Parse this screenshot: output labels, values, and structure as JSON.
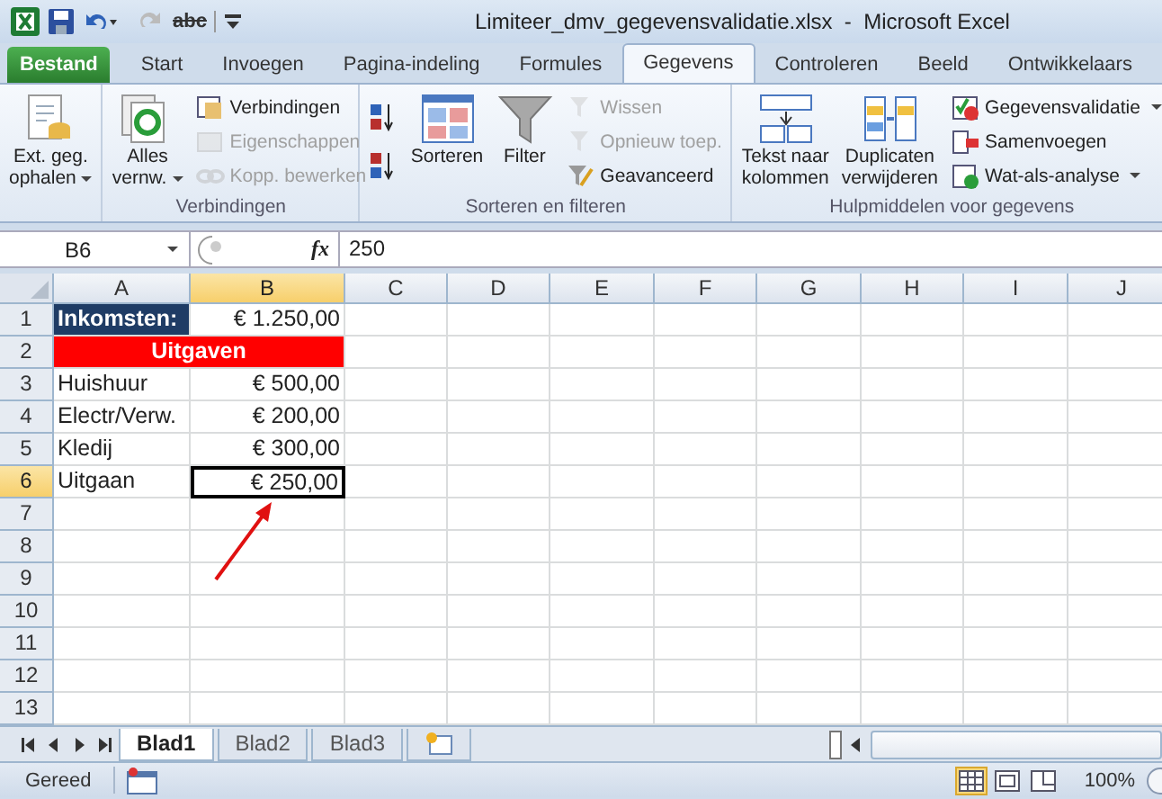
{
  "window": {
    "title": "Limiteer_dmv_gegevensvalidatie.xlsx  -  Microsoft Excel",
    "quick_access": {
      "spelling_label": "abc",
      "redo_disabled": true
    }
  },
  "tabs": [
    {
      "label": "Bestand",
      "kind": "file",
      "selected": false
    },
    {
      "label": "Start",
      "kind": "tab",
      "selected": false
    },
    {
      "label": "Invoegen",
      "kind": "tab",
      "selected": false
    },
    {
      "label": "Pagina-indeling",
      "kind": "tab",
      "selected": false
    },
    {
      "label": "Formules",
      "kind": "tab",
      "selected": false
    },
    {
      "label": "Gegevens",
      "kind": "tab",
      "selected": true
    },
    {
      "label": "Controleren",
      "kind": "tab",
      "selected": false
    },
    {
      "label": "Beeld",
      "kind": "tab",
      "selected": false
    },
    {
      "label": "Ontwikkelaars",
      "kind": "tab",
      "selected": false
    }
  ],
  "ribbon": {
    "groups": [
      {
        "buttons": [
          {
            "label": "Ext. geg.\nophalen",
            "kind": "large",
            "dropdown": true,
            "disabled": false
          }
        ]
      },
      {
        "label": "Verbindingen",
        "buttons": [
          {
            "label": "Alles\nvernw.",
            "kind": "large",
            "dropdown": true,
            "disabled": false
          },
          {
            "label": "Verbindingen",
            "kind": "small",
            "dropdown": false,
            "disabled": false
          },
          {
            "label": "Eigenschappen",
            "kind": "small",
            "dropdown": false,
            "disabled": true
          },
          {
            "label": "Kopp. bewerken",
            "kind": "small",
            "dropdown": false,
            "disabled": true
          }
        ]
      },
      {
        "label": "Sorteren en filteren",
        "buttons": [
          {
            "kind": "icon",
            "dropdown": false,
            "disabled": false
          },
          {
            "kind": "icon",
            "dropdown": false,
            "disabled": false
          },
          {
            "label": "Sorteren",
            "kind": "large",
            "dropdown": false,
            "disabled": false
          },
          {
            "label": "Filter",
            "kind": "large",
            "dropdown": false,
            "disabled": false
          },
          {
            "label": "Wissen",
            "kind": "small",
            "dropdown": false,
            "disabled": true
          },
          {
            "label": "Opnieuw toep.",
            "kind": "small",
            "dropdown": false,
            "disabled": true
          },
          {
            "label": "Geavanceerd",
            "kind": "small",
            "dropdown": false,
            "disabled": false
          }
        ]
      },
      {
        "label": "Hulpmiddelen voor gegevens",
        "buttons": [
          {
            "label": "Tekst naar\nkolommen",
            "kind": "large",
            "dropdown": false,
            "disabled": false
          },
          {
            "label": "Duplicaten\nverwijderen",
            "kind": "large",
            "dropdown": false,
            "disabled": false
          },
          {
            "label": "Gegevensvalidatie",
            "kind": "small",
            "dropdown": true,
            "disabled": false
          },
          {
            "label": "Samenvoegen",
            "kind": "small",
            "dropdown": false,
            "disabled": false
          },
          {
            "label": "Wat-als-analyse",
            "kind": "small",
            "dropdown": true,
            "disabled": false
          }
        ]
      }
    ]
  },
  "formula_bar": {
    "name_box": "B6",
    "function_label": "fx",
    "value": "250"
  },
  "sheet": {
    "columns": [
      {
        "label": "A",
        "selected": false
      },
      {
        "label": "B",
        "selected": true
      },
      {
        "label": "C",
        "selected": false
      },
      {
        "label": "D",
        "selected": false
      },
      {
        "label": "E",
        "selected": false
      },
      {
        "label": "F",
        "selected": false
      },
      {
        "label": "G",
        "selected": false
      },
      {
        "label": "H",
        "selected": false
      },
      {
        "label": "I",
        "selected": false
      },
      {
        "label": "J",
        "selected": false
      }
    ],
    "rows": [
      {
        "number": "1",
        "selected": false,
        "cells": [
          {
            "text": "Inkomsten:",
            "kind": "heading",
            "selected": false
          },
          {
            "text": "€ 1.250,00",
            "kind": "amount",
            "selected": false
          }
        ]
      },
      {
        "number": "2",
        "selected": false,
        "cells": [
          {
            "text": "Uitgaven",
            "kind": "banner",
            "selected": false
          }
        ]
      },
      {
        "number": "3",
        "selected": false,
        "cells": [
          {
            "text": "Huishuur",
            "kind": "label",
            "selected": false
          },
          {
            "text": "€ 500,00",
            "kind": "amount",
            "selected": false
          }
        ]
      },
      {
        "number": "4",
        "selected": false,
        "cells": [
          {
            "text": "Electr/Verw.",
            "kind": "label",
            "selected": false
          },
          {
            "text": "€ 200,00",
            "kind": "amount",
            "selected": false
          }
        ]
      },
      {
        "number": "5",
        "selected": false,
        "cells": [
          {
            "text": "Kledij",
            "kind": "label",
            "selected": false
          },
          {
            "text": "€ 300,00",
            "kind": "amount",
            "selected": false
          }
        ]
      },
      {
        "number": "6",
        "selected": true,
        "cells": [
          {
            "text": "Uitgaan",
            "kind": "label",
            "selected": false
          },
          {
            "text": "€ 250,00",
            "kind": "amount",
            "selected": true
          }
        ]
      },
      {
        "number": "7",
        "selected": false,
        "cells": []
      },
      {
        "number": "8",
        "selected": false,
        "cells": []
      },
      {
        "number": "9",
        "selected": false,
        "cells": []
      },
      {
        "number": "10",
        "selected": false,
        "cells": []
      },
      {
        "number": "11",
        "selected": false,
        "cells": []
      },
      {
        "number": "12",
        "selected": false,
        "cells": []
      },
      {
        "number": "13",
        "selected": false,
        "cells": []
      }
    ]
  },
  "sheet_tabs": [
    {
      "label": "Blad1",
      "selected": true
    },
    {
      "label": "Blad2",
      "selected": false
    },
    {
      "label": "Blad3",
      "selected": false
    }
  ],
  "status_bar": {
    "status": "Gereed",
    "views": [
      {
        "selected": true
      },
      {
        "selected": false
      },
      {
        "selected": false
      }
    ],
    "zoom": "100%"
  }
}
